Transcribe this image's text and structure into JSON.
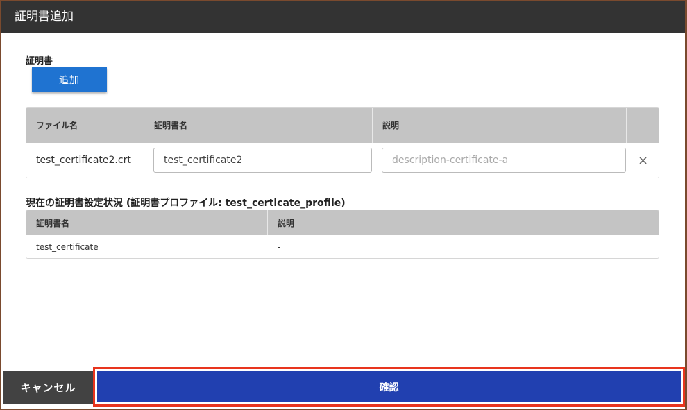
{
  "dialog": {
    "title": "証明書追加"
  },
  "certificate_section": {
    "label": "証明書",
    "add_button": "追加",
    "columns": [
      "ファイル名",
      "証明書名",
      "説明"
    ],
    "row": {
      "file_name": "test_certificate2.crt",
      "cert_name_value": "test_certificate2",
      "description_placeholder": "description-certificate-a"
    }
  },
  "current_section": {
    "label": "現在の証明書設定状況 (証明書プロファイル: test_certicate_profile)",
    "columns": [
      "証明書名",
      "説明"
    ],
    "rows": [
      {
        "name": "test_certificate",
        "description": "-"
      }
    ]
  },
  "footer": {
    "cancel_label": "キャンセル",
    "confirm_label": "確認",
    "confirm_highlight_color": "#e8351e"
  },
  "icons": {
    "remove_row": "×"
  }
}
